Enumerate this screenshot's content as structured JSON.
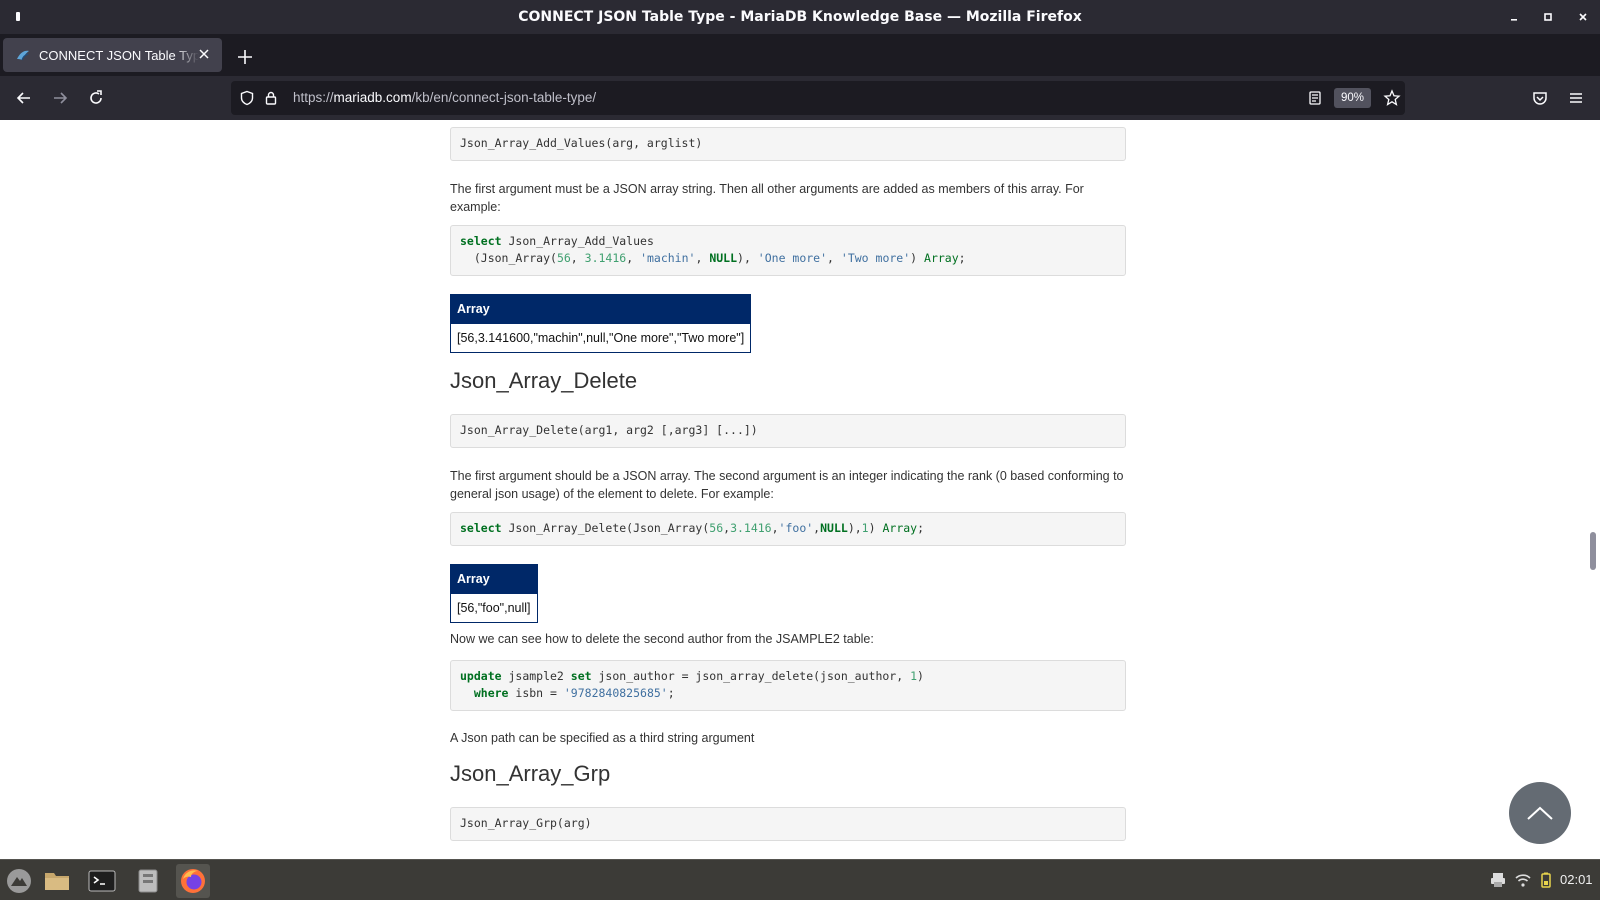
{
  "window": {
    "title": "CONNECT JSON Table Type - MariaDB Knowledge Base — Mozilla Firefox"
  },
  "tabs": [
    {
      "title": "CONNECT JSON Table Type - MariaDB Knowledge Base",
      "active": true
    }
  ],
  "nav": {
    "url_host": "mariadb.com",
    "url_prefix": "https://",
    "url_path": "/kb/en/connect-json-table-type/",
    "zoom": "90%"
  },
  "article": {
    "code1": "Json_Array_Add_Values(arg, arglist)",
    "para1": "The first argument must be a JSON array string. Then all other arguments are added as members of this array. For example:",
    "table1": {
      "header": "Array",
      "value": "[56,3.141600,\"machin\",null,\"One more\",\"Two more\"]"
    },
    "h_delete": "Json_Array_Delete",
    "code3": "Json_Array_Delete(arg1, arg2 [,arg3] [...])",
    "para2": "The first argument should be a JSON array. The second argument is an integer indicating the rank (0 based conforming to general json usage) of the element to delete. For example:",
    "table2": {
      "header": "Array",
      "value": "[56,\"foo\",null]"
    },
    "para3": "Now we can see how to delete the second author from the JSAMPLE2 table:",
    "para4": "A Json path can be specified as a third string argument",
    "h_grp": "Json_Array_Grp",
    "code6": "Json_Array_Grp(arg)"
  },
  "taskbar": {
    "clock": "02:01"
  },
  "colors": {
    "table_header": "#002868",
    "keyword": "#007020",
    "number": "#40a070",
    "string": "#4070a0"
  }
}
